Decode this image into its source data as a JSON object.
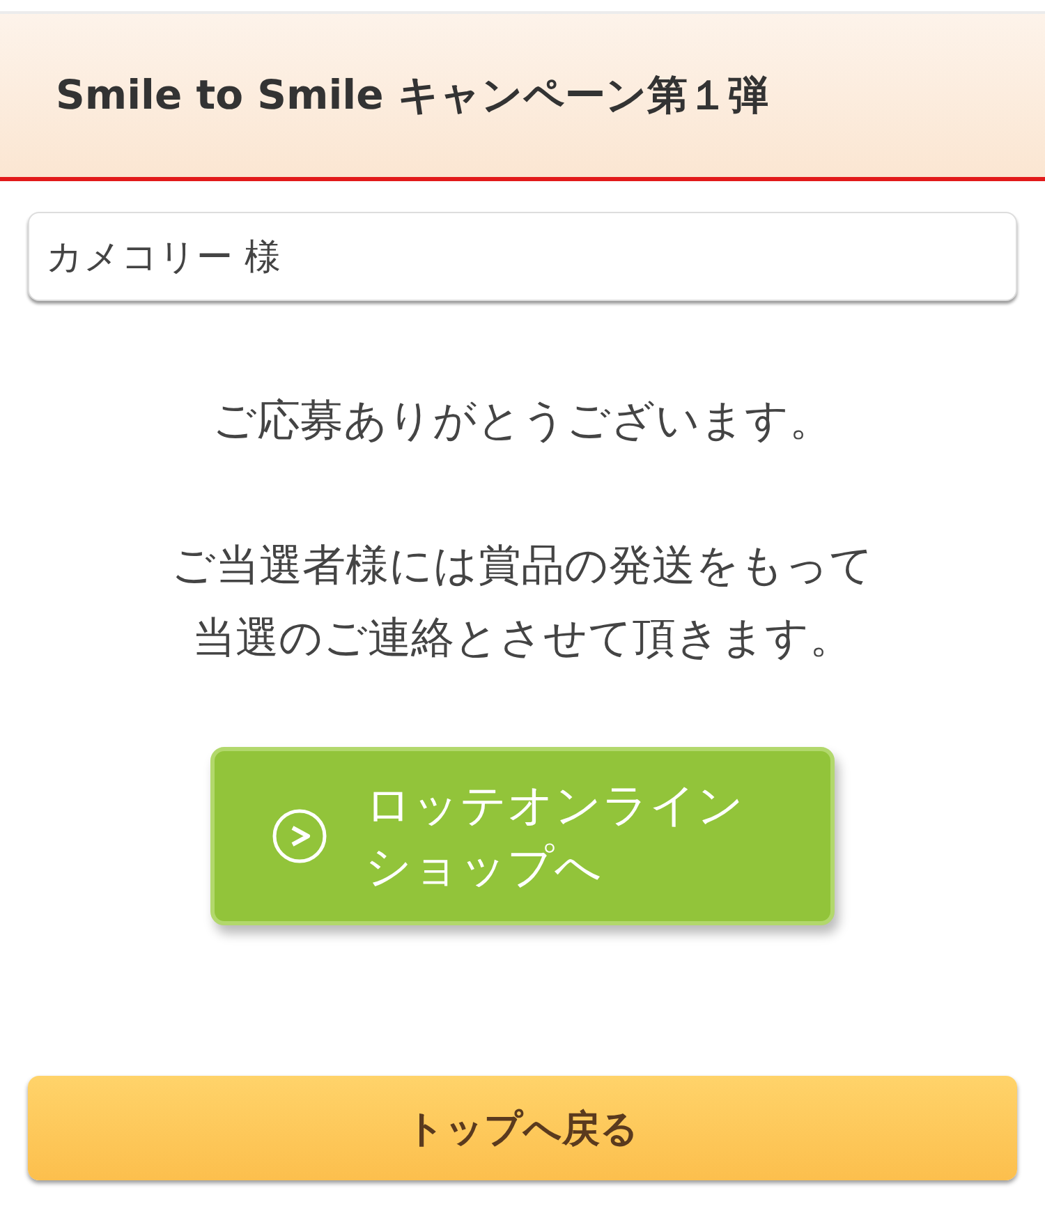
{
  "header": {
    "title": "Smile to Smile キャンペーン第１弾"
  },
  "name_field": {
    "value": "カメコリー 様"
  },
  "messages": [
    {
      "lines": [
        "ご応募ありがとうございます。"
      ]
    },
    {
      "lines": [
        "ご当選者様には賞品の発送をもって",
        "当選のご連絡とさせて頂きます。"
      ]
    }
  ],
  "shop_button": {
    "lines": [
      "ロッテオンライン",
      "ショップへ"
    ]
  },
  "back_button": {
    "label": "トップへ戻る"
  }
}
